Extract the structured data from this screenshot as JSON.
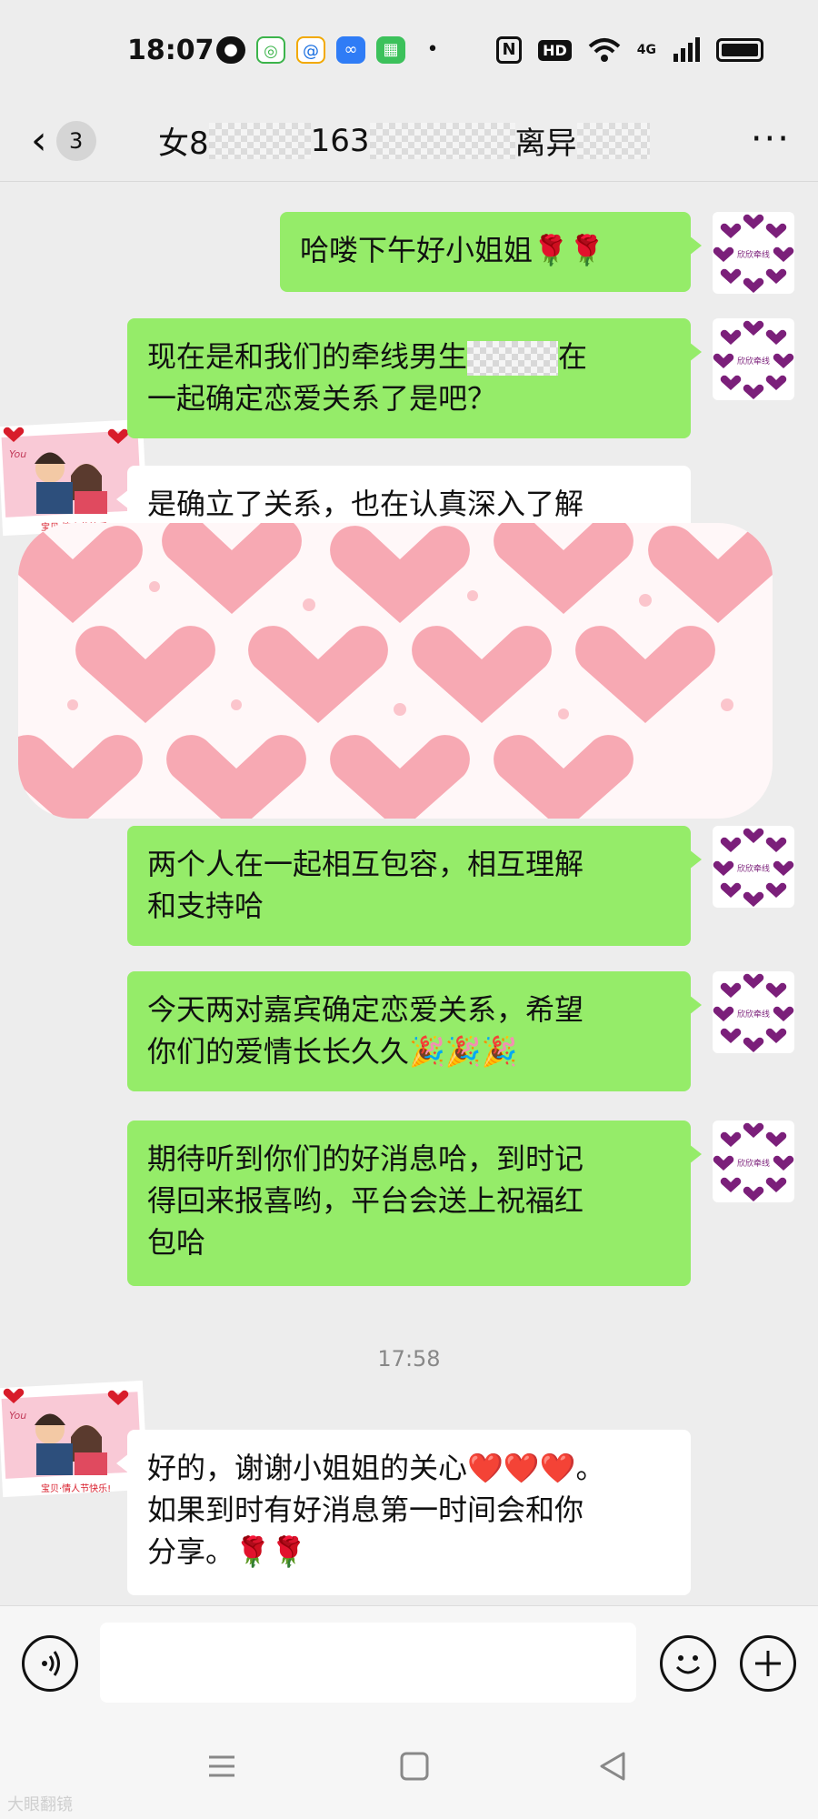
{
  "status_bar": {
    "time": "18:07",
    "network": "4G",
    "hd": "HD",
    "nfc": "N",
    "app_icons": [
      "wechat-icon",
      "message-icon",
      "q-icon",
      "cloud-icon",
      "app-icon",
      "dot-icon"
    ]
  },
  "header": {
    "unread_count": "3",
    "title_prefix": "女8",
    "title_mid": "163",
    "title_tag": "离异"
  },
  "brand_avatar_text": "欣欣牵线",
  "user_avatar": {
    "caption": "宝贝·情人节快乐!",
    "text": "You"
  },
  "messages": [
    {
      "id": "m1",
      "side": "out",
      "text": "哈喽下午好小姐姐🌹🌹"
    },
    {
      "id": "m2",
      "side": "out",
      "line1_a": "现在是和我们的牵线男生",
      "line1_b": "在",
      "line2": "一起确定恋爱关系了是吧？"
    },
    {
      "id": "m3",
      "side": "in",
      "text": "是确立了关系，也在认真深入了解"
    },
    {
      "id": "m4",
      "side": "out",
      "line1": "两个人在一起相互包容，相互理解",
      "line2": "和支持哈"
    },
    {
      "id": "m5",
      "side": "out",
      "line1": "今天两对嘉宾确定恋爱关系，希望",
      "line2": "你们的爱情长长久久🎉🎉🎉"
    },
    {
      "id": "m6",
      "side": "out",
      "line1": "期待听到你们的好消息哈，到时记",
      "line2": "得回来报喜哟，平台会送上祝福红",
      "line3": "包哈"
    },
    {
      "id": "m7",
      "side": "in",
      "line1": "好的，谢谢小姐姐的关心❤️❤️❤️。",
      "line2": "如果到时有好消息第一时间会和你",
      "line3": "分享。🌹🌹"
    }
  ],
  "time_divider": "17:58",
  "watermark": "大眼翻镜",
  "colors": {
    "outgoing_bubble": "#95ec69",
    "incoming_bubble": "#ffffff",
    "brand_purple": "#7b1f7a",
    "background": "#ededed"
  }
}
